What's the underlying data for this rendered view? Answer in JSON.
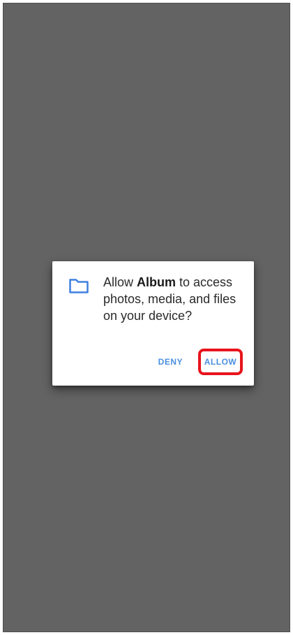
{
  "dialog": {
    "message_prefix": "Allow ",
    "app_name": "Album",
    "message_suffix": " to access photos, media, and files on your device?",
    "deny_label": "DENY",
    "allow_label": "ALLOW"
  },
  "icons": {
    "folder": "folder-icon"
  },
  "colors": {
    "overlay": "#636363",
    "accent": "#4a8fe0",
    "highlight": "#e8141c",
    "dialog_bg": "#ffffff"
  }
}
